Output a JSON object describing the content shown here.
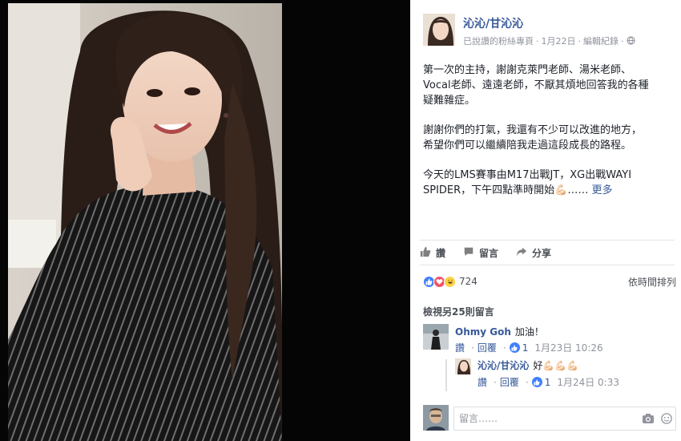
{
  "post": {
    "page_name": "沁沁/甘沁沁",
    "meta_liked": "已說讚的粉絲專頁",
    "meta_date": "1月22日",
    "meta_edit": "編輯紀錄",
    "body_p1": "第一次的主持，謝謝克萊門老師、湯米老師、\nVocal老師、遠遠老師，不厭其煩地回答我的各種\n疑難雜症。",
    "body_p2": "謝謝你們的打氣，我還有不少可以改進的地方，\n希望你們可以繼續陪我走過這段成長的路程。",
    "body_p3": "今天的LMS賽事由M17出戰JT，XG出戰WAYI\nSPIDER，下午四點準時開始💪🏻……",
    "see_more": "更多"
  },
  "actions": {
    "like": "讚",
    "comment": "留言",
    "share": "分享"
  },
  "reactions": {
    "count": "724",
    "sort": "依時間排列"
  },
  "comments": {
    "view_more": "檢視另25則留言",
    "items": [
      {
        "author": "Ohmy Goh",
        "text": "加油！",
        "like": "讚",
        "reply": "回覆",
        "likes": "1",
        "time": "1月23日 10:26"
      },
      {
        "author": "沁沁/甘沁沁",
        "text": "好💪🏻💪🏻💪🏻",
        "like": "讚",
        "reply": "回覆",
        "likes": "1",
        "time": "1月24日 0:33"
      }
    ]
  },
  "composer": {
    "placeholder": "留言……"
  },
  "colors": {
    "link": "#365899",
    "meta": "#90949c",
    "like_blue": "#4080ff",
    "love_red": "#f25268",
    "haha_yellow": "#fcd24a"
  },
  "icons": [
    "globe-icon",
    "thumbs-up-icon",
    "comment-icon",
    "share-icon",
    "like-reaction-icon",
    "love-reaction-icon",
    "haha-reaction-icon",
    "camera-icon",
    "sticker-icon"
  ]
}
